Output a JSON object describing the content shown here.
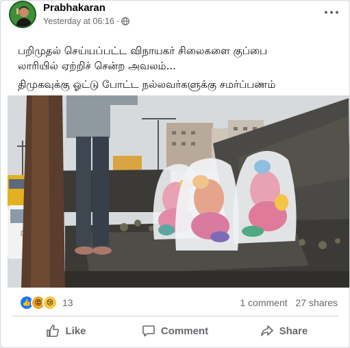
{
  "post": {
    "author": "Prabhakaran",
    "timestamp": "Yesterday at 06:16",
    "privacy_icon": "globe-icon",
    "more_icon": "more-options-icon",
    "text_lines": [
      "பறிமுதல் செய்யப்பட்ட விநாயகர் சிலைகளை குப்பை",
      "லாரியில் ஏற்றிச் சென்ற அவலம்...",
      "திமுகவுக்கு ஓட்டு போட்ட நல்லவர்களுக்கு சமர்ப்பணம்"
    ]
  },
  "reactions": {
    "types": [
      "like",
      "angry",
      "sad"
    ],
    "count": "13"
  },
  "stats": {
    "comments": "1 comment",
    "shares": "27 shares"
  },
  "actions": {
    "like": "Like",
    "comment": "Comment",
    "share": "Share"
  },
  "colors": {
    "like_blue": "#1877f2",
    "text_dark": "#050505",
    "text_muted": "#65676b"
  }
}
